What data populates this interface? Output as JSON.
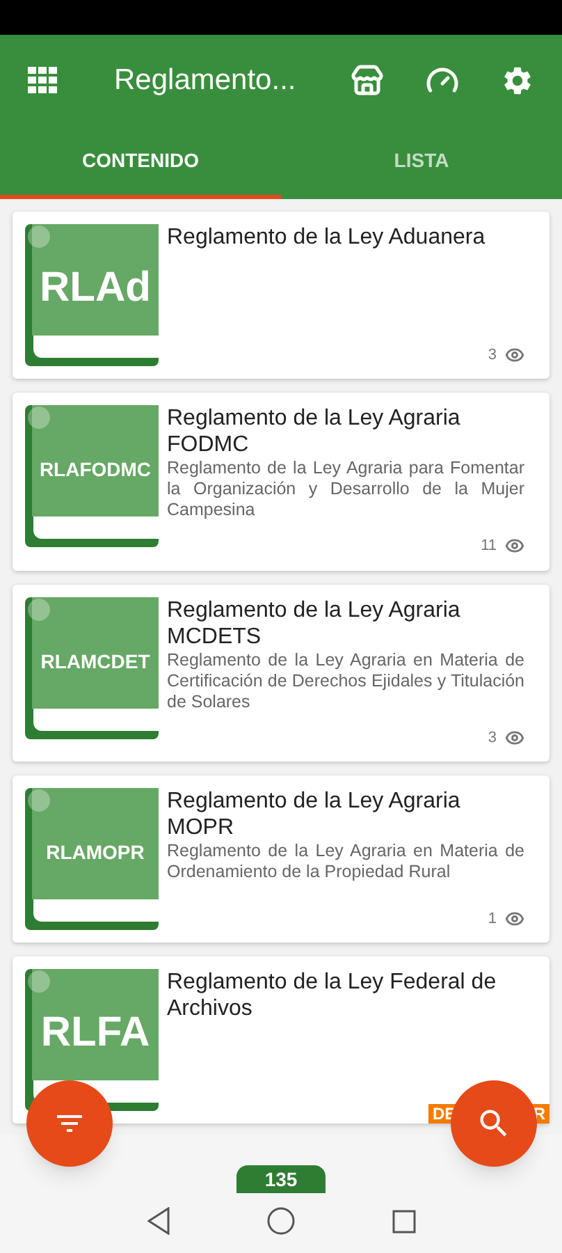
{
  "app_bar": {
    "title": "Reglamento..."
  },
  "tabs": [
    {
      "label": "CONTENIDO",
      "selected": true
    },
    {
      "label": "LISTA",
      "selected": false
    }
  ],
  "items": [
    {
      "code": "RLAd",
      "title": "Reglamento de la Ley Aduanera",
      "views": "3"
    },
    {
      "code": "RLAFODMC",
      "title": "Reglamento de la Ley Agraria FODMC",
      "description": "Reglamento de la Ley Agraria para Fomentar la Organización y Desarrollo de la Mujer Campesina",
      "views": "11"
    },
    {
      "code": "RLAMCDET",
      "title": "Reglamento de la Ley Agraria MCDETS",
      "description": "Reglamento de la Ley Agraria en Materia de Certificación de Derechos Ejidales y Titulación de Solares",
      "views": "3"
    },
    {
      "code": "RLAMOPR",
      "title": "Reglamento de la Ley Agraria MOPR",
      "description": "Reglamento de la Ley Agraria en Materia de Ordenamiento de la Propiedad Rural",
      "views": "1"
    },
    {
      "code": "RLFA",
      "title": "Reglamento de la Ley Federal de Archivos",
      "ribbon": [
        "DE",
        "R"
      ]
    }
  ],
  "count_badge": "135"
}
